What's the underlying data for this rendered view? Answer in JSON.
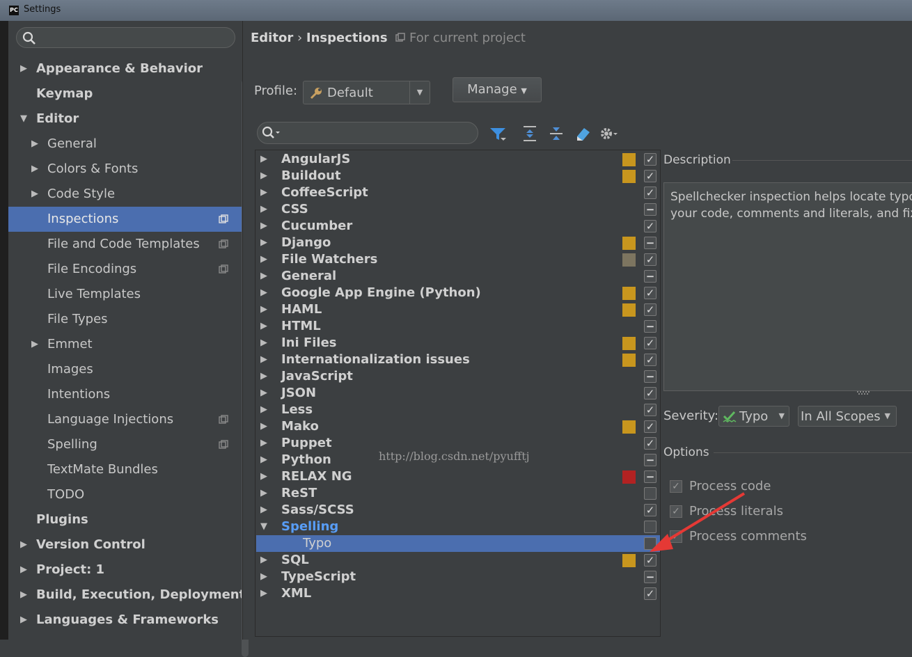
{
  "window": {
    "title": "Settings",
    "app_icon": "PC"
  },
  "sidebar": {
    "search_placeholder": "",
    "items": [
      {
        "label": "Appearance & Behavior",
        "level": 0,
        "arrow": "right",
        "bold": true
      },
      {
        "label": "Keymap",
        "level": 0,
        "arrow": "",
        "bold": true
      },
      {
        "label": "Editor",
        "level": 0,
        "arrow": "down",
        "bold": true
      },
      {
        "label": "General",
        "level": 1,
        "arrow": "right"
      },
      {
        "label": "Colors & Fonts",
        "level": 1,
        "arrow": "right"
      },
      {
        "label": "Code Style",
        "level": 1,
        "arrow": "right"
      },
      {
        "label": "Inspections",
        "level": 1,
        "arrow": "",
        "selected": true,
        "copy": true
      },
      {
        "label": "File and Code Templates",
        "level": 1,
        "arrow": "",
        "copy": true
      },
      {
        "label": "File Encodings",
        "level": 1,
        "arrow": "",
        "copy": true
      },
      {
        "label": "Live Templates",
        "level": 1,
        "arrow": ""
      },
      {
        "label": "File Types",
        "level": 1,
        "arrow": ""
      },
      {
        "label": "Emmet",
        "level": 1,
        "arrow": "right"
      },
      {
        "label": "Images",
        "level": 1,
        "arrow": ""
      },
      {
        "label": "Intentions",
        "level": 1,
        "arrow": ""
      },
      {
        "label": "Language Injections",
        "level": 1,
        "arrow": "",
        "copy": true
      },
      {
        "label": "Spelling",
        "level": 1,
        "arrow": "",
        "copy": true
      },
      {
        "label": "TextMate Bundles",
        "level": 1,
        "arrow": ""
      },
      {
        "label": "TODO",
        "level": 1,
        "arrow": ""
      },
      {
        "label": "Plugins",
        "level": 0,
        "arrow": "",
        "bold": true
      },
      {
        "label": "Version Control",
        "level": 0,
        "arrow": "right",
        "bold": true
      },
      {
        "label": "Project: 1",
        "level": 0,
        "arrow": "right",
        "bold": true
      },
      {
        "label": "Build, Execution, Deployment",
        "level": 0,
        "arrow": "right",
        "bold": true
      },
      {
        "label": "Languages & Frameworks",
        "level": 0,
        "arrow": "right",
        "bold": true
      }
    ]
  },
  "header": {
    "crumb_editor": "Editor",
    "crumb_sep": "›",
    "crumb_inspections": "Inspections",
    "project_label": "For current project"
  },
  "profile": {
    "label": "Profile:",
    "value": "Default",
    "manage_label": "Manage"
  },
  "inspections": [
    {
      "label": "AngularJS",
      "sev": "#c8961e",
      "state": "check"
    },
    {
      "label": "Buildout",
      "sev": "#c8961e",
      "state": "check"
    },
    {
      "label": "CoffeeScript",
      "sev": "",
      "state": "check"
    },
    {
      "label": "CSS",
      "sev": "",
      "state": "minus"
    },
    {
      "label": "Cucumber",
      "sev": "",
      "state": "check"
    },
    {
      "label": "Django",
      "sev": "#c8961e",
      "state": "minus"
    },
    {
      "label": "File Watchers",
      "sev": "#7d7560",
      "state": "check"
    },
    {
      "label": "General",
      "sev": "",
      "state": "minus"
    },
    {
      "label": "Google App Engine (Python)",
      "sev": "#c8961e",
      "state": "check"
    },
    {
      "label": "HAML",
      "sev": "#c8961e",
      "state": "check"
    },
    {
      "label": "HTML",
      "sev": "",
      "state": "minus"
    },
    {
      "label": "Ini Files",
      "sev": "#c8961e",
      "state": "check"
    },
    {
      "label": "Internationalization issues",
      "sev": "#c8961e",
      "state": "check"
    },
    {
      "label": "JavaScript",
      "sev": "",
      "state": "minus"
    },
    {
      "label": "JSON",
      "sev": "",
      "state": "check"
    },
    {
      "label": "Less",
      "sev": "",
      "state": "check"
    },
    {
      "label": "Mako",
      "sev": "#c8961e",
      "state": "check"
    },
    {
      "label": "Puppet",
      "sev": "",
      "state": "check"
    },
    {
      "label": "Python",
      "sev": "",
      "state": "minus"
    },
    {
      "label": "RELAX NG",
      "sev": "#b22222",
      "state": "minus"
    },
    {
      "label": "ReST",
      "sev": "",
      "state": "empty"
    },
    {
      "label": "Sass/SCSS",
      "sev": "",
      "state": "check"
    },
    {
      "label": "Spelling",
      "sev": "",
      "state": "empty",
      "expanded": true,
      "blue": true
    },
    {
      "label": "Typo",
      "sev": "",
      "state": "empty",
      "child": true,
      "selected": true
    },
    {
      "label": "SQL",
      "sev": "#c8961e",
      "state": "check"
    },
    {
      "label": "TypeScript",
      "sev": "",
      "state": "minus"
    },
    {
      "label": "XML",
      "sev": "",
      "state": "check"
    }
  ],
  "watermark": "http://blog.csdn.net/pyufftj",
  "description": {
    "label": "Description",
    "text_line1": "Spellchecker inspection helps locate typo",
    "text_line2": "your code, comments and literals, and fix"
  },
  "severity": {
    "label": "Severity:",
    "value": "Typo",
    "scope": "In All Scopes"
  },
  "options": {
    "label": "Options",
    "items": [
      {
        "label": "Process code",
        "checked": true
      },
      {
        "label": "Process literals",
        "checked": true
      },
      {
        "label": "Process comments",
        "checked": true
      }
    ]
  },
  "colors": {
    "selection": "#4b6eaf",
    "background": "#3c3f41",
    "link_blue": "#589df6",
    "annotation_arrow": "#e53935"
  }
}
